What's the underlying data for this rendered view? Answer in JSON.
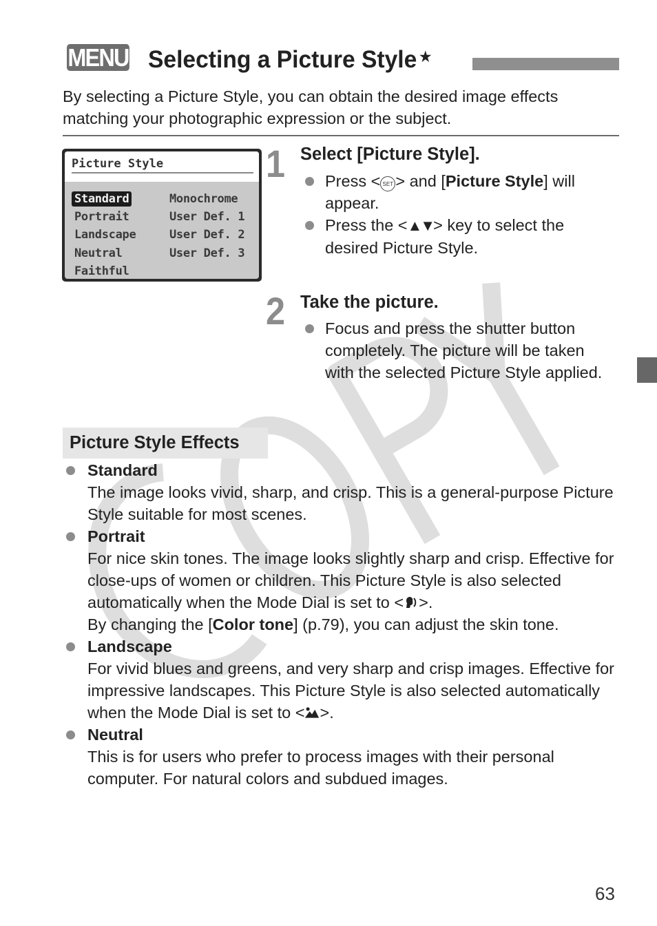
{
  "header": {
    "menu_badge": "MENU",
    "title": "Selecting a Picture Style",
    "title_mark": "★"
  },
  "intro": "By selecting a Picture Style, you can obtain the desired image effects matching your photographic expression or the subject.",
  "lcd_screen": {
    "title": "Picture Style",
    "selected": "Standard",
    "left_column": [
      "Standard",
      "Portrait",
      "Landscape",
      "Neutral",
      "Faithful"
    ],
    "right_column": [
      "Monochrome",
      "User Def. 1",
      "User Def. 2",
      "User Def. 3"
    ]
  },
  "steps": [
    {
      "number": "1",
      "heading": "Select [Picture Style].",
      "bullets": [
        {
          "pre": "Press <",
          "icon": "set-button-icon",
          "icon_text": "SET",
          "mid": "> and [",
          "bold": "Picture Style",
          "post": "] will appear."
        },
        {
          "pre": "Press the <",
          "icon": "up-down-arrow-keys-icon",
          "icon_text": "▲▼",
          "post": "> key to select the desired Picture Style."
        }
      ]
    },
    {
      "number": "2",
      "heading": "Take the picture.",
      "bullets": [
        {
          "text": "Focus and press the shutter button completely. The picture will be taken with the selected Picture Style applied."
        }
      ]
    }
  ],
  "effects": {
    "heading": "Picture Style Effects",
    "items": [
      {
        "name": "Standard",
        "desc": "The image looks vivid, sharp, and crisp. This is a general-purpose Picture Style suitable for most scenes."
      },
      {
        "name": "Portrait",
        "desc_1": "For nice skin tones. The image looks slightly sharp and crisp. Effective for close-ups of women or children. This Picture Style is also selected automatically when the Mode Dial is set to <",
        "icon": "portrait-mode-icon",
        "desc_2": ">.",
        "desc_3_pre": "By changing the [",
        "desc_3_bold": "Color tone",
        "desc_3_post": "] (p.79), you can adjust the skin tone."
      },
      {
        "name": "Landscape",
        "desc_1": "For vivid blues and greens, and very sharp and crisp images. Effective for impressive landscapes. This Picture Style is also selected automatically when the Mode Dial is set to <",
        "icon": "landscape-mode-icon",
        "desc_2": ">."
      },
      {
        "name": "Neutral",
        "desc": "This is for users who prefer to process images with their personal computer. For natural colors and subdued images."
      }
    ]
  },
  "watermark": "COPY",
  "page_number": "63",
  "colors": {
    "badge": "#6e6e6e",
    "title_bar": "#8f8f8f",
    "side_tab": "#676767",
    "bullet": "#8c8c8c",
    "effects_head_bg": "#e6e6e6",
    "watermark": "#dadada"
  }
}
